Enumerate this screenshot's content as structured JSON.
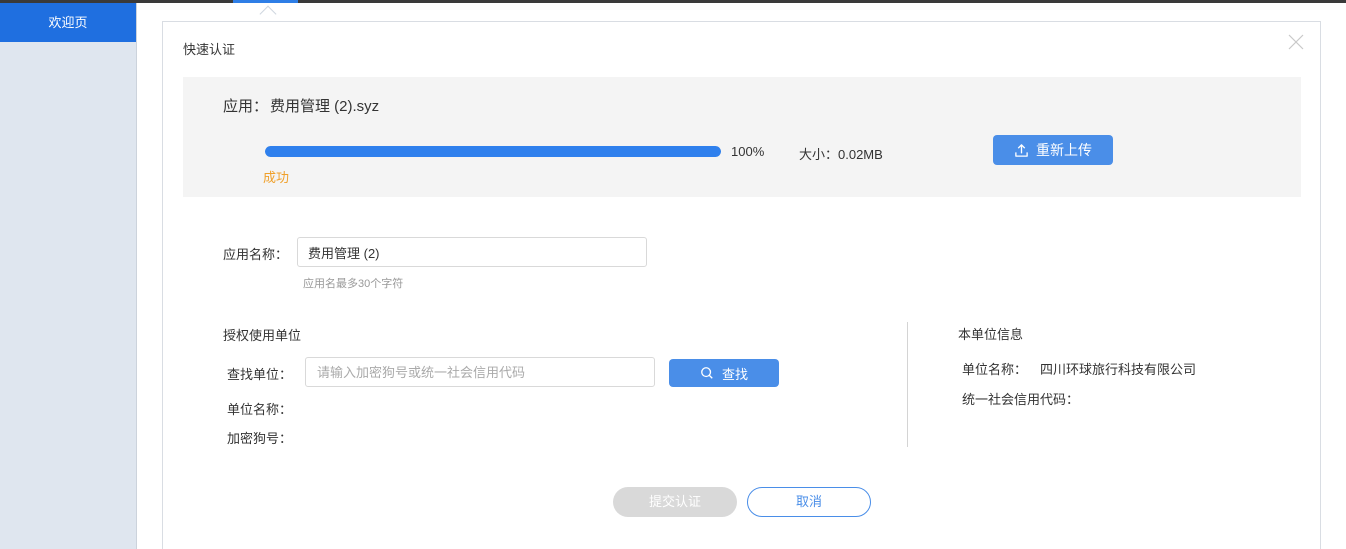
{
  "sidebar": {
    "items": [
      {
        "label": "欢迎页",
        "active": true
      }
    ]
  },
  "dialog": {
    "title": "快速认证",
    "upload": {
      "app_label": "应用：",
      "file_name": "费用管理 (2).syz",
      "progress": 100,
      "progress_text": "100%",
      "size_text": "大小：0.02MB",
      "status": "成功",
      "reupload_label": "重新上传"
    },
    "app_name": {
      "label": "应用名称：",
      "value": "费用管理 (2)",
      "hint": "应用名最多30个字符"
    },
    "authorized_unit": {
      "title": "授权使用单位",
      "search_label": "查找单位：",
      "search_placeholder": "请输入加密狗号或统一社会信用代码",
      "search_button": "查找",
      "unit_name_label": "单位名称：",
      "dongle_label": "加密狗号："
    },
    "own_unit": {
      "title": "本单位信息",
      "name_label": "单位名称：",
      "name_value": "四川环球旅行科技有限公司",
      "credit_code_label": "统一社会信用代码："
    },
    "buttons": {
      "submit": "提交认证",
      "cancel": "取消"
    }
  },
  "colors": {
    "primary": "#4a8ee8",
    "sidebar_active": "#1f6fe0",
    "success_text": "#f0a02a",
    "disabled": "#d9d9d9"
  },
  "icons": {
    "close": "close-icon",
    "upload": "upload-icon",
    "search": "search-icon"
  }
}
